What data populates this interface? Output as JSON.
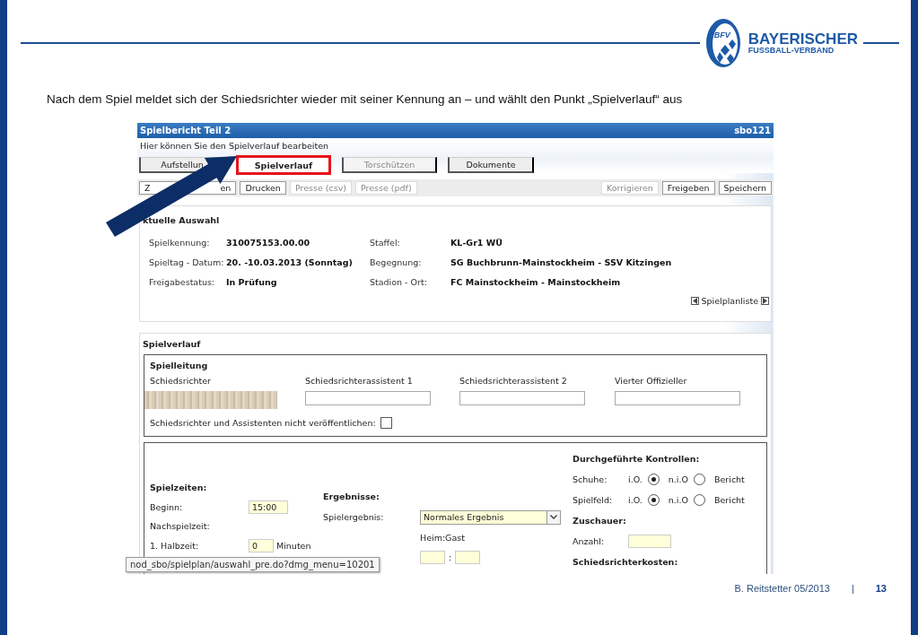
{
  "slide": {
    "caption": "Nach dem Spiel meldet sich der Schiedsrichter wieder mit seiner Kennung an – und wählt den Punkt „Spielverlauf“ aus",
    "logo": {
      "badge": "BFV",
      "line1": "BAYERISCHER",
      "line2": "FUSSBALL-VERBAND"
    },
    "footer": {
      "author": "B. Reitstetter  05/2013",
      "separator": "|",
      "page": "13"
    }
  },
  "app": {
    "title": "Spielbericht Teil 2",
    "code": "sbo121",
    "hint": "Hier können Sie den Spielverlauf bearbeiten",
    "tabs": [
      {
        "label": "Aufstellun",
        "selected": false,
        "disabled": false,
        "highlighted": false
      },
      {
        "label": "Spielverlauf",
        "selected": true,
        "disabled": false,
        "highlighted": true
      },
      {
        "label": "Torschützen",
        "selected": false,
        "disabled": true,
        "highlighted": false
      },
      {
        "label": "Dokumente",
        "selected": false,
        "disabled": false,
        "highlighted": false
      }
    ],
    "toolbar_left": [
      {
        "label_parts": [
          "Z",
          "en"
        ],
        "disabled": false
      },
      {
        "label_parts": [
          "Drucken"
        ],
        "disabled": false
      },
      {
        "label_parts": [
          "Presse (csv)"
        ],
        "disabled": true
      },
      {
        "label_parts": [
          "Presse (pdf)"
        ],
        "disabled": true
      }
    ],
    "toolbar_right": [
      {
        "label_parts": [
          "Korrigieren"
        ],
        "disabled": true
      },
      {
        "label_parts": [
          "Freigeben"
        ],
        "disabled": false
      },
      {
        "label_parts": [
          "Speichern"
        ],
        "disabled": false
      }
    ],
    "selection": {
      "title": "ktuelle Auswahl",
      "fields": [
        {
          "label": "Spielkennung:",
          "value": "310075153.00.00"
        },
        {
          "label": "Staffel:",
          "value": "KL-Gr1 WÜ"
        },
        {
          "label": "Spieltag - Datum:",
          "value": "20. -10.03.2013 (Sonntag)"
        },
        {
          "label": "Begegnung:",
          "value": "SG Buchbrunn-Mainstockheim - SSV Kitzingen"
        },
        {
          "label": "Freigabestatus:",
          "value": "In Prüfung"
        },
        {
          "label": "Stadion - Ort:",
          "value": "FC Mainstockheim - Mainstockheim"
        }
      ],
      "nav_label": "Spielplanliste"
    },
    "course": {
      "title": "Spielverlauf",
      "leadership": {
        "title": "Spielleitung",
        "officials": [
          {
            "label": "Schiedsrichter",
            "redacted": true
          },
          {
            "label": "Schiedsrichterassistent 1",
            "redacted": false
          },
          {
            "label": "Schiedsrichterassistent 2",
            "redacted": false
          },
          {
            "label": "Vierter Offizieller",
            "redacted": false
          }
        ],
        "hide_option": {
          "label": "Schiedsrichter und Assistenten nicht veröffentlichen:",
          "checked": false
        }
      },
      "times": {
        "title": "Spielzeiten:",
        "start_label": "Beginn:",
        "start_value": "15:00",
        "extra_label": "Nachspielzeit:",
        "half_label": "1. Halbzeit:",
        "half_value": "0",
        "unit": "Minuten"
      },
      "results": {
        "title": "Ergebnisse:",
        "label": "Spielergebnis:",
        "value": "Normales Ergebnis",
        "score_label": "Heim:Gast",
        "score_separator": ":"
      },
      "checks": {
        "title": "Durchgeführte Kontrollen:",
        "rows": [
          {
            "label": "Schuhe:",
            "options": [
              {
                "label": "i.O.",
                "selected": true
              },
              {
                "label": "n.i.O",
                "selected": false
              }
            ],
            "report": "Bericht"
          },
          {
            "label": "Spielfeld:",
            "options": [
              {
                "label": "i.O.",
                "selected": true
              },
              {
                "label": "n.i.O",
                "selected": false
              }
            ],
            "report": "Bericht"
          }
        ]
      },
      "spectators": {
        "title": "Zuschauer:",
        "label": "Anzahl:"
      },
      "costs": {
        "title": "Schiedsrichterkosten:"
      }
    },
    "tooltip": "nod_sbo/spielplan/auswahl_pre.do?dmg_menu=10201"
  }
}
